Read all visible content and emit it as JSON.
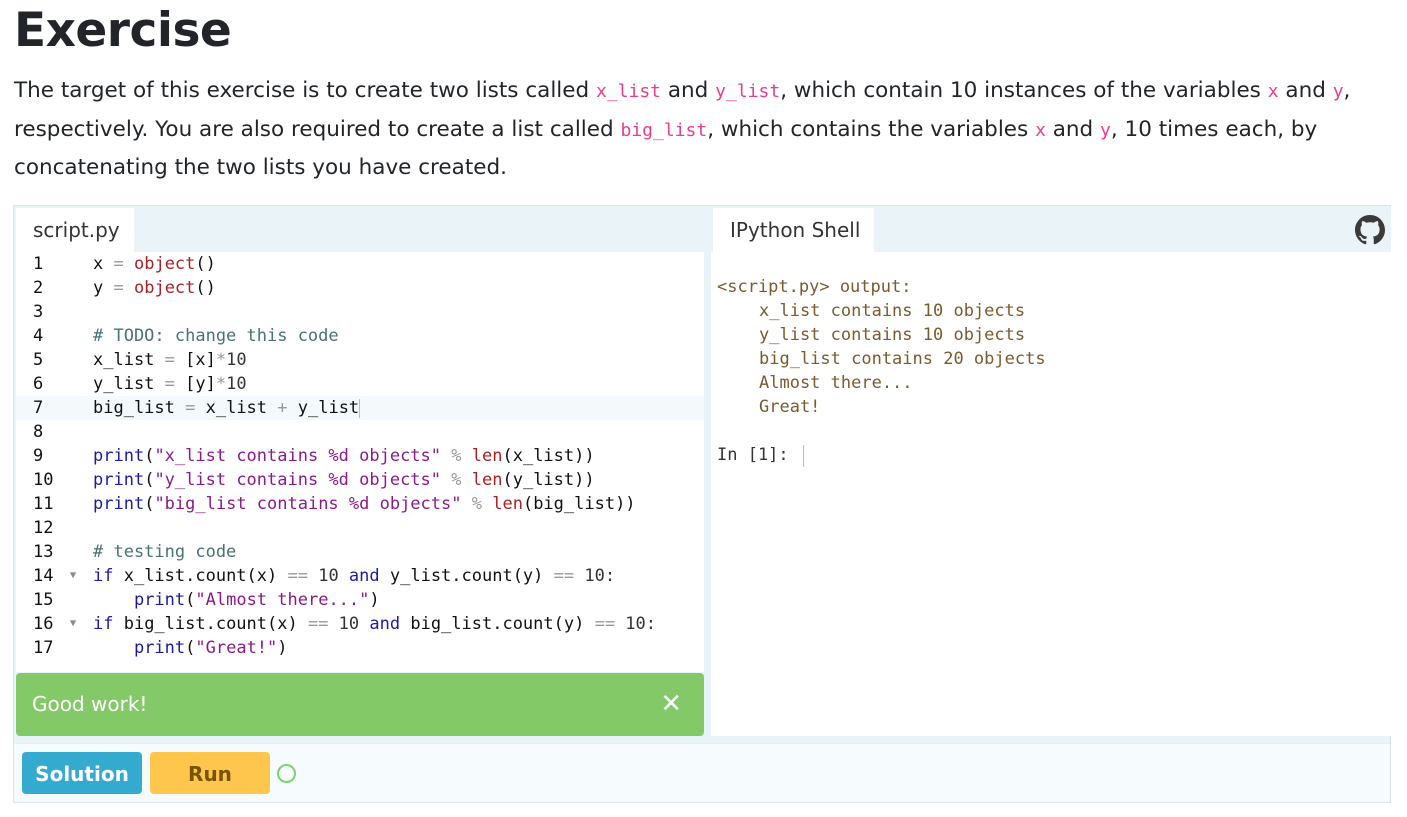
{
  "page": {
    "title": "Exercise",
    "description": {
      "p1": "The target of this exercise is to create two lists called ",
      "c1": "x_list",
      "p2": " and ",
      "c2": "y_list",
      "p3": ", which contain 10 instances of the variables ",
      "c3": "x",
      "p4": " and ",
      "c4": "y",
      "p5": ", respectively. You are also required to create a list called ",
      "c5": "big_list",
      "p6": ", which contains the variables ",
      "c6": "x",
      "p7": " and ",
      "c7": "y",
      "p8": ", 10 times each, by concatenating the two lists you have created."
    }
  },
  "editor": {
    "tab_label": "script.py",
    "line_numbers": [
      "1",
      "2",
      "3",
      "4",
      "5",
      "6",
      "7",
      "8",
      "9",
      "10",
      "11",
      "12",
      "13",
      "14",
      "15",
      "16",
      "17"
    ],
    "fold_marker": "▼",
    "code": {
      "l1": {
        "a": "x ",
        "b": "=",
        "c": " ",
        "d": "object",
        "e": "()"
      },
      "l2": {
        "a": "y ",
        "b": "=",
        "c": " ",
        "d": "object",
        "e": "()"
      },
      "l4": "# TODO: change this code",
      "l5": {
        "a": "x_list ",
        "b": "=",
        "c": " [x]",
        "d": "*",
        "e": "10"
      },
      "l6": {
        "a": "y_list ",
        "b": "=",
        "c": " [y]",
        "d": "*",
        "e": "10"
      },
      "l7": {
        "a": "big_list ",
        "b": "=",
        "c": " x_list ",
        "d": "+",
        "e": " y_list"
      },
      "l9": {
        "a": "print",
        "b": "(",
        "c": "\"x_list contains %d objects\"",
        "d": " ",
        "e": "%",
        "f": " ",
        "g": "len",
        "h": "(x_list))"
      },
      "l10": {
        "a": "print",
        "b": "(",
        "c": "\"y_list contains %d objects\"",
        "d": " ",
        "e": "%",
        "f": " ",
        "g": "len",
        "h": "(y_list))"
      },
      "l11": {
        "a": "print",
        "b": "(",
        "c": "\"big_list contains %d objects\"",
        "d": " ",
        "e": "%",
        "f": " ",
        "g": "len",
        "h": "(big_list))"
      },
      "l13": "# testing code",
      "l14": {
        "a": "if",
        "b": " x_list.count(x) ",
        "c": "==",
        "d": " 10 ",
        "e": "and",
        "f": " y_list.count(y) ",
        "g": "==",
        "h": " 10:"
      },
      "l15": {
        "a": "    ",
        "b": "print",
        "c": "(",
        "d": "\"Almost there...\"",
        "e": ")"
      },
      "l16": {
        "a": "if",
        "b": " big_list.count(x) ",
        "c": "==",
        "d": " 10 ",
        "e": "and",
        "f": " big_list.count(y) ",
        "g": "==",
        "h": " 10:"
      },
      "l17": {
        "a": "    ",
        "b": "print",
        "c": "(",
        "d": "\"Great!\"",
        "e": ")"
      }
    }
  },
  "feedback": {
    "message": "Good work!",
    "close_glyph": "✕"
  },
  "shell": {
    "tab_label": "IPython Shell",
    "output_header": "<script.py> output:",
    "output_lines": [
      "x_list contains 10 objects",
      "y_list contains 10 objects",
      "big_list contains 20 objects",
      "Almost there...",
      "Great!"
    ],
    "prompt": "In [1]:"
  },
  "toolbar": {
    "solution_label": "Solution",
    "run_label": "Run"
  },
  "icons": {
    "github": "github-icon",
    "status": "status-ring-icon",
    "close": "close-icon"
  },
  "colors": {
    "feedback_bg": "#84c968",
    "solution_btn": "#35aacf",
    "run_btn": "#ffc64d",
    "inline_code": "#e83e8c"
  }
}
